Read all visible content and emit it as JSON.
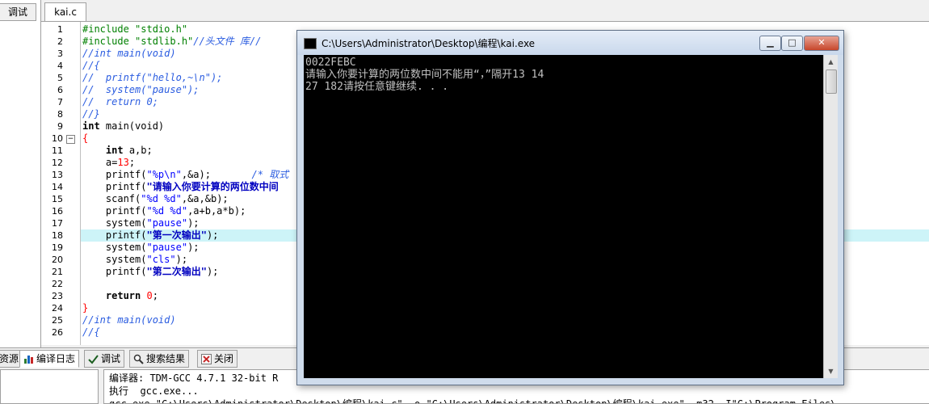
{
  "left_panel": {
    "tab_label": "调试"
  },
  "editor": {
    "file_tab": "kai.c",
    "line_numbers": [
      "1",
      "2",
      "3",
      "4",
      "5",
      "6",
      "7",
      "8",
      "9",
      "10",
      "11",
      "12",
      "13",
      "14",
      "15",
      "16",
      "17",
      "18",
      "19",
      "20",
      "21",
      "22",
      "23",
      "24",
      "25",
      "26"
    ],
    "fold_markers": {
      "line10": "−",
      "line24_end": "└"
    },
    "lines": {
      "l1": {
        "pp": "#include \"stdio.h\""
      },
      "l2": {
        "pp": "#include \"stdlib.h\"",
        "cm": "//头文件 库//"
      },
      "l3": {
        "cm": "//int main(void)"
      },
      "l4": {
        "cm": "//{"
      },
      "l5": {
        "cm": "//  printf(\"hello,~\\n\");"
      },
      "l6": {
        "cm": "//  system(\"pause\");"
      },
      "l7": {
        "cm": "//  return 0;"
      },
      "l8": {
        "cm": "//}"
      },
      "l9": {
        "kw": "int",
        "tx": " main(void)"
      },
      "l10": {
        "op": "{"
      },
      "l11": {
        "ind": "    ",
        "kw": "int",
        "tx": " a,b;"
      },
      "l12": {
        "ind": "    ",
        "tx": "a=",
        "nm": "13",
        "tx2": ";"
      },
      "l13": {
        "ind": "    ",
        "tx": "printf(",
        "st": "\"%p\\n\"",
        "tx2": ",&a);",
        "gap": "       ",
        "cm": "/* 取式"
      },
      "l14": {
        "ind": "    ",
        "tx": "printf(",
        "cs": "\"请输入你要计算的两位数中间"
      },
      "l15": {
        "ind": "    ",
        "tx": "scanf(",
        "st": "\"%d %d\"",
        "tx2": ",&a,&b);"
      },
      "l16": {
        "ind": "    ",
        "tx": "printf(",
        "st": "\"%d %d\"",
        "tx2": ",a+b,a*b);"
      },
      "l17": {
        "ind": "    ",
        "tx": "system(",
        "st": "\"pause\"",
        "tx2": ");"
      },
      "l18": {
        "ind": "    ",
        "tx": "printf(",
        "cs": "\"第一次输出\"",
        "tx2": ");"
      },
      "l19": {
        "ind": "    ",
        "tx": "system(",
        "st": "\"pause\"",
        "tx2": ");"
      },
      "l20": {
        "ind": "    ",
        "tx": "system(",
        "st": "\"cls\"",
        "tx2": ");"
      },
      "l21": {
        "ind": "    ",
        "tx": "printf(",
        "cs": "\"第二次输出\"",
        "tx2": ");"
      },
      "l22": {
        "tx": ""
      },
      "l23": {
        "ind": "    ",
        "kw": "return",
        "tx": " ",
        "nm": "0",
        "tx2": ";"
      },
      "l24": {
        "op": "}"
      },
      "l25": {
        "cm": "//int main(void)"
      },
      "l26": {
        "cm": "//{"
      }
    }
  },
  "console": {
    "title": "C:\\Users\\Administrator\\Desktop\\编程\\kai.exe",
    "buttons": {
      "minimize": "▁",
      "maximize": "□",
      "close": "✕"
    },
    "output": [
      "0022FEBC",
      "请输入你要计算的两位数中间不能用“，”隔开13 14",
      "27 182请按任意键继续. . ."
    ]
  },
  "bottom": {
    "tabs": [
      "资源",
      "编译日志",
      "调试",
      "搜索结果",
      "关闭"
    ],
    "log": [
      "编译器: TDM-GCC 4.7.1 32-bit R",
      "执行  gcc.exe...",
      "gcc.exe \"C:\\Users\\Administrator\\Desktop\\编程\\kai.c\" -o \"C:\\Users\\Administrator\\Desktop\\编程\\kai.exe\" -m32 -I\"C:\\Program Files\\"
    ]
  },
  "colors": {
    "highlight_line": "#cdf4f8",
    "comment": "#2a5ce0",
    "string": "#0000ff",
    "preprocessor": "#008000"
  }
}
